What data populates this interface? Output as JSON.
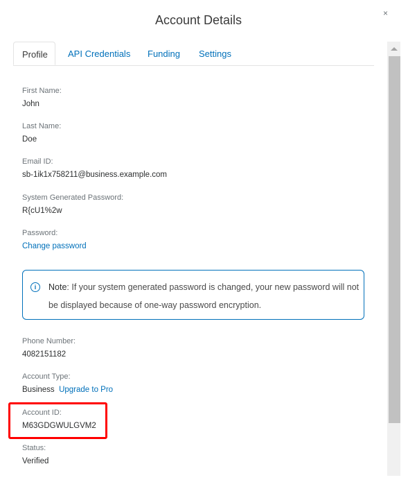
{
  "dialog": {
    "title": "Account Details",
    "close_label": "×"
  },
  "tabs": [
    {
      "label": "Profile",
      "active": true
    },
    {
      "label": "API Credentials",
      "active": false
    },
    {
      "label": "Funding",
      "active": false
    },
    {
      "label": "Settings",
      "active": false
    }
  ],
  "profile": {
    "first_name": {
      "label": "First Name:",
      "value": "John"
    },
    "last_name": {
      "label": "Last Name:",
      "value": "Doe"
    },
    "email": {
      "label": "Email ID:",
      "value": "sb-1ik1x758211@business.example.com"
    },
    "system_password": {
      "label": "System Generated Password:",
      "value": "R{cU1%2w"
    },
    "password": {
      "label": "Password:",
      "link": "Change password"
    },
    "note": {
      "icon": "info-icon",
      "prefix": "Note",
      "text": ": If your system generated password is changed, your new password will not be displayed because of one-way password encryption."
    },
    "phone": {
      "label": "Phone Number:",
      "value": "4082151182"
    },
    "account_type": {
      "label": "Account Type:",
      "value": "Business",
      "link": "Upgrade to Pro"
    },
    "account_id": {
      "label": "Account ID:",
      "value": "M63GDGWULGVM2"
    },
    "status": {
      "label": "Status:",
      "value": "Verified"
    }
  },
  "colors": {
    "link": "#0070ba",
    "highlight": "#ff0000"
  }
}
